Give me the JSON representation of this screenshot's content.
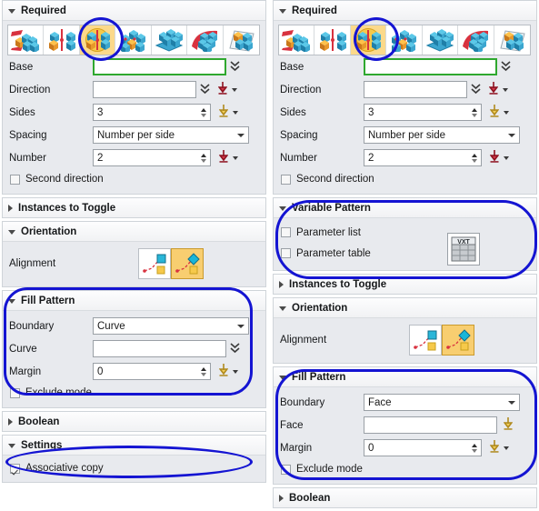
{
  "app": {
    "accent_selection": "#1414d2",
    "selected_icon_highlight": "#fbd98a",
    "required_field_border": "#2fa82f"
  },
  "left_panel": {
    "groups": {
      "required": {
        "title": "Required",
        "expanded": true,
        "toolbar": {
          "name": "pattern-type-toolbar",
          "selected_index": 2,
          "items": [
            {
              "name": "linear-pattern-icon",
              "label": "Linear"
            },
            {
              "name": "circular-pattern-icon",
              "label": "Circular"
            },
            {
              "name": "polygon-pattern-icon",
              "label": "Polygon"
            },
            {
              "name": "spiral-pattern-icon",
              "label": "Spiral"
            },
            {
              "name": "along-pattern-icon",
              "label": "Along"
            },
            {
              "name": "general-pattern-icon",
              "label": "General"
            },
            {
              "name": "reference-pattern-icon",
              "label": "Reference"
            }
          ]
        },
        "rows": [
          {
            "label": "Base",
            "type": "select-field",
            "value": "",
            "required": true
          },
          {
            "label": "Direction",
            "type": "select-field",
            "value": "",
            "required": false
          },
          {
            "label": "Sides",
            "type": "stepper",
            "value": "3"
          },
          {
            "label": "Spacing",
            "type": "combo",
            "value": "Number per side"
          },
          {
            "label": "Number",
            "type": "stepper",
            "value": "2"
          }
        ],
        "checkbox": {
          "label": "Second direction",
          "checked": false
        }
      },
      "instances_to_toggle": {
        "title": "Instances to Toggle",
        "expanded": false
      },
      "orientation": {
        "title": "Orientation",
        "expanded": true,
        "alignment_label": "Alignment",
        "alignment_options": [
          {
            "name": "alignment-follow-pattern-icon",
            "selected": false
          },
          {
            "name": "alignment-fixed-icon",
            "selected": true
          }
        ]
      },
      "fill_pattern": {
        "title": "Fill Pattern",
        "expanded": true,
        "highlighted": true,
        "rows": [
          {
            "label": "Boundary",
            "type": "combo",
            "value": "Curve"
          },
          {
            "label": "Curve",
            "type": "select-field",
            "value": ""
          },
          {
            "label": "Margin",
            "type": "stepper",
            "value": "0"
          }
        ],
        "checkbox": {
          "label": "Exclude mode",
          "checked": false
        }
      },
      "boolean": {
        "title": "Boolean",
        "expanded": false
      },
      "settings": {
        "title": "Settings",
        "expanded": true,
        "checkbox": {
          "label": "Associative copy",
          "checked": true,
          "highlighted": true
        }
      }
    }
  },
  "right_panel": {
    "groups": {
      "required": {
        "title": "Required",
        "expanded": true,
        "toolbar": {
          "name": "pattern-type-toolbar",
          "selected_index": 2,
          "items": [
            {
              "name": "linear-pattern-icon",
              "label": "Linear"
            },
            {
              "name": "circular-pattern-icon",
              "label": "Circular"
            },
            {
              "name": "polygon-pattern-icon",
              "label": "Polygon"
            },
            {
              "name": "spiral-pattern-icon",
              "label": "Spiral"
            },
            {
              "name": "along-pattern-icon",
              "label": "Along"
            },
            {
              "name": "general-pattern-icon",
              "label": "General"
            },
            {
              "name": "reference-pattern-icon",
              "label": "Reference"
            }
          ]
        },
        "rows": [
          {
            "label": "Base",
            "type": "select-field",
            "value": "",
            "required": true
          },
          {
            "label": "Direction",
            "type": "select-field",
            "value": "",
            "required": false
          },
          {
            "label": "Sides",
            "type": "stepper",
            "value": "3"
          },
          {
            "label": "Spacing",
            "type": "combo",
            "value": "Number per side"
          },
          {
            "label": "Number",
            "type": "stepper",
            "value": "2"
          }
        ],
        "checkbox": {
          "label": "Second direction",
          "checked": false
        }
      },
      "variable_pattern": {
        "title": "Variable Pattern",
        "expanded": true,
        "highlighted": true,
        "checkboxes": [
          {
            "label": "Parameter list",
            "checked": false
          },
          {
            "label": "Parameter table",
            "checked": false
          }
        ],
        "table_icon": {
          "name": "parameter-table-icon",
          "caption": "VXT"
        }
      },
      "instances_to_toggle": {
        "title": "Instances to Toggle",
        "expanded": false
      },
      "orientation": {
        "title": "Orientation",
        "expanded": true,
        "alignment_label": "Alignment",
        "alignment_options": [
          {
            "name": "alignment-follow-pattern-icon",
            "selected": false
          },
          {
            "name": "alignment-fixed-icon",
            "selected": true
          }
        ]
      },
      "fill_pattern": {
        "title": "Fill Pattern",
        "expanded": true,
        "highlighted": true,
        "rows": [
          {
            "label": "Boundary",
            "type": "combo",
            "value": "Face"
          },
          {
            "label": "Face",
            "type": "select-field",
            "value": ""
          },
          {
            "label": "Margin",
            "type": "stepper",
            "value": "0"
          }
        ],
        "checkbox": {
          "label": "Exclude mode",
          "checked": false
        }
      },
      "boolean": {
        "title": "Boolean",
        "expanded": false
      }
    }
  }
}
